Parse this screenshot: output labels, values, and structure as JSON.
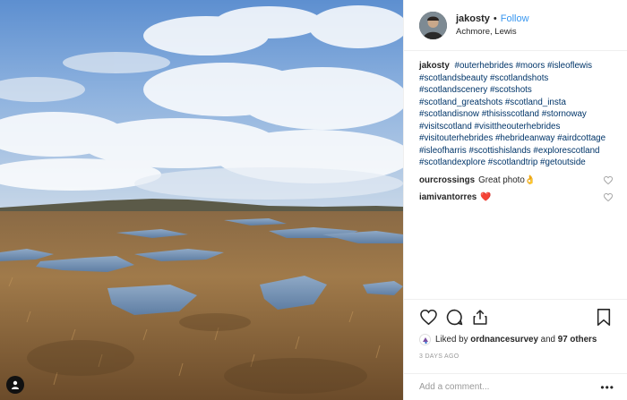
{
  "post": {
    "username": "jakosty",
    "follow_label": "Follow",
    "location": "Achmore, Lewis",
    "separator": "•"
  },
  "caption": {
    "username": "jakosty",
    "text": "#outerhebrides #moors #isleoflewis #scotlandsbeauty #scotlandshots #scotlandscenery #scotshots #scotland_greatshots #scotland_insta #scotlandisnow #thisisscotland #stornoway #visitscotland #visittheouterhebrides #visitouterhebrides #hebrideanway #airdcottage #isleofharris #scottishislands #explorescotland #scotlandexplore #scotlandtrip #getoutside"
  },
  "comments": [
    {
      "username": "ourcrossings",
      "text": "Great photo👌"
    },
    {
      "username": "iamivantorres",
      "text": "❤️"
    }
  ],
  "likes": {
    "prefix": "Liked by",
    "user": "ordnancesurvey",
    "and": "and",
    "others": "97 others"
  },
  "date": "3 DAYS AGO",
  "add_comment": {
    "placeholder": "Add a comment..."
  },
  "more_label": "•••",
  "icons": {
    "like": "heart-icon",
    "comment": "comment-icon",
    "share": "share-icon",
    "save": "bookmark-icon",
    "tag": "user-tag-icon"
  },
  "colors": {
    "link": "#3897f0",
    "hashtag": "#003569",
    "heart": "#ed4956",
    "muted": "#999999"
  }
}
